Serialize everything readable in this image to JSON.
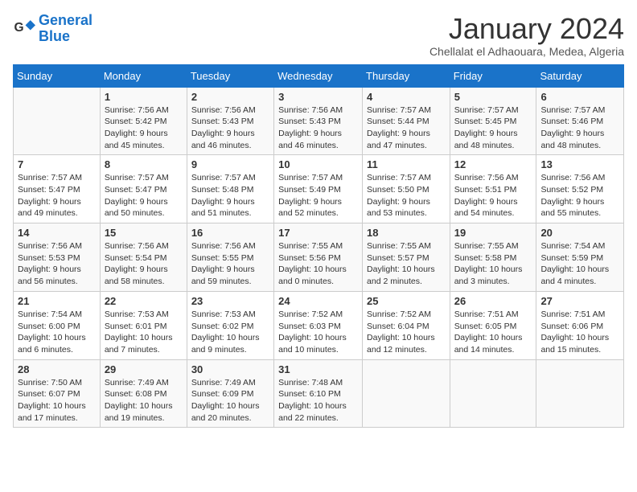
{
  "logo": {
    "text_general": "General",
    "text_blue": "Blue"
  },
  "header": {
    "title": "January 2024",
    "subtitle": "Chellalat el Adhaouara, Medea, Algeria"
  },
  "weekdays": [
    "Sunday",
    "Monday",
    "Tuesday",
    "Wednesday",
    "Thursday",
    "Friday",
    "Saturday"
  ],
  "weeks": [
    [
      {
        "day": "",
        "sunrise": "",
        "sunset": "",
        "daylight": ""
      },
      {
        "day": "1",
        "sunrise": "Sunrise: 7:56 AM",
        "sunset": "Sunset: 5:42 PM",
        "daylight": "Daylight: 9 hours and 45 minutes."
      },
      {
        "day": "2",
        "sunrise": "Sunrise: 7:56 AM",
        "sunset": "Sunset: 5:43 PM",
        "daylight": "Daylight: 9 hours and 46 minutes."
      },
      {
        "day": "3",
        "sunrise": "Sunrise: 7:56 AM",
        "sunset": "Sunset: 5:43 PM",
        "daylight": "Daylight: 9 hours and 46 minutes."
      },
      {
        "day": "4",
        "sunrise": "Sunrise: 7:57 AM",
        "sunset": "Sunset: 5:44 PM",
        "daylight": "Daylight: 9 hours and 47 minutes."
      },
      {
        "day": "5",
        "sunrise": "Sunrise: 7:57 AM",
        "sunset": "Sunset: 5:45 PM",
        "daylight": "Daylight: 9 hours and 48 minutes."
      },
      {
        "day": "6",
        "sunrise": "Sunrise: 7:57 AM",
        "sunset": "Sunset: 5:46 PM",
        "daylight": "Daylight: 9 hours and 48 minutes."
      }
    ],
    [
      {
        "day": "7",
        "sunrise": "Sunrise: 7:57 AM",
        "sunset": "Sunset: 5:47 PM",
        "daylight": "Daylight: 9 hours and 49 minutes."
      },
      {
        "day": "8",
        "sunrise": "Sunrise: 7:57 AM",
        "sunset": "Sunset: 5:47 PM",
        "daylight": "Daylight: 9 hours and 50 minutes."
      },
      {
        "day": "9",
        "sunrise": "Sunrise: 7:57 AM",
        "sunset": "Sunset: 5:48 PM",
        "daylight": "Daylight: 9 hours and 51 minutes."
      },
      {
        "day": "10",
        "sunrise": "Sunrise: 7:57 AM",
        "sunset": "Sunset: 5:49 PM",
        "daylight": "Daylight: 9 hours and 52 minutes."
      },
      {
        "day": "11",
        "sunrise": "Sunrise: 7:57 AM",
        "sunset": "Sunset: 5:50 PM",
        "daylight": "Daylight: 9 hours and 53 minutes."
      },
      {
        "day": "12",
        "sunrise": "Sunrise: 7:56 AM",
        "sunset": "Sunset: 5:51 PM",
        "daylight": "Daylight: 9 hours and 54 minutes."
      },
      {
        "day": "13",
        "sunrise": "Sunrise: 7:56 AM",
        "sunset": "Sunset: 5:52 PM",
        "daylight": "Daylight: 9 hours and 55 minutes."
      }
    ],
    [
      {
        "day": "14",
        "sunrise": "Sunrise: 7:56 AM",
        "sunset": "Sunset: 5:53 PM",
        "daylight": "Daylight: 9 hours and 56 minutes."
      },
      {
        "day": "15",
        "sunrise": "Sunrise: 7:56 AM",
        "sunset": "Sunset: 5:54 PM",
        "daylight": "Daylight: 9 hours and 58 minutes."
      },
      {
        "day": "16",
        "sunrise": "Sunrise: 7:56 AM",
        "sunset": "Sunset: 5:55 PM",
        "daylight": "Daylight: 9 hours and 59 minutes."
      },
      {
        "day": "17",
        "sunrise": "Sunrise: 7:55 AM",
        "sunset": "Sunset: 5:56 PM",
        "daylight": "Daylight: 10 hours and 0 minutes."
      },
      {
        "day": "18",
        "sunrise": "Sunrise: 7:55 AM",
        "sunset": "Sunset: 5:57 PM",
        "daylight": "Daylight: 10 hours and 2 minutes."
      },
      {
        "day": "19",
        "sunrise": "Sunrise: 7:55 AM",
        "sunset": "Sunset: 5:58 PM",
        "daylight": "Daylight: 10 hours and 3 minutes."
      },
      {
        "day": "20",
        "sunrise": "Sunrise: 7:54 AM",
        "sunset": "Sunset: 5:59 PM",
        "daylight": "Daylight: 10 hours and 4 minutes."
      }
    ],
    [
      {
        "day": "21",
        "sunrise": "Sunrise: 7:54 AM",
        "sunset": "Sunset: 6:00 PM",
        "daylight": "Daylight: 10 hours and 6 minutes."
      },
      {
        "day": "22",
        "sunrise": "Sunrise: 7:53 AM",
        "sunset": "Sunset: 6:01 PM",
        "daylight": "Daylight: 10 hours and 7 minutes."
      },
      {
        "day": "23",
        "sunrise": "Sunrise: 7:53 AM",
        "sunset": "Sunset: 6:02 PM",
        "daylight": "Daylight: 10 hours and 9 minutes."
      },
      {
        "day": "24",
        "sunrise": "Sunrise: 7:52 AM",
        "sunset": "Sunset: 6:03 PM",
        "daylight": "Daylight: 10 hours and 10 minutes."
      },
      {
        "day": "25",
        "sunrise": "Sunrise: 7:52 AM",
        "sunset": "Sunset: 6:04 PM",
        "daylight": "Daylight: 10 hours and 12 minutes."
      },
      {
        "day": "26",
        "sunrise": "Sunrise: 7:51 AM",
        "sunset": "Sunset: 6:05 PM",
        "daylight": "Daylight: 10 hours and 14 minutes."
      },
      {
        "day": "27",
        "sunrise": "Sunrise: 7:51 AM",
        "sunset": "Sunset: 6:06 PM",
        "daylight": "Daylight: 10 hours and 15 minutes."
      }
    ],
    [
      {
        "day": "28",
        "sunrise": "Sunrise: 7:50 AM",
        "sunset": "Sunset: 6:07 PM",
        "daylight": "Daylight: 10 hours and 17 minutes."
      },
      {
        "day": "29",
        "sunrise": "Sunrise: 7:49 AM",
        "sunset": "Sunset: 6:08 PM",
        "daylight": "Daylight: 10 hours and 19 minutes."
      },
      {
        "day": "30",
        "sunrise": "Sunrise: 7:49 AM",
        "sunset": "Sunset: 6:09 PM",
        "daylight": "Daylight: 10 hours and 20 minutes."
      },
      {
        "day": "31",
        "sunrise": "Sunrise: 7:48 AM",
        "sunset": "Sunset: 6:10 PM",
        "daylight": "Daylight: 10 hours and 22 minutes."
      },
      {
        "day": "",
        "sunrise": "",
        "sunset": "",
        "daylight": ""
      },
      {
        "day": "",
        "sunrise": "",
        "sunset": "",
        "daylight": ""
      },
      {
        "day": "",
        "sunrise": "",
        "sunset": "",
        "daylight": ""
      }
    ]
  ]
}
